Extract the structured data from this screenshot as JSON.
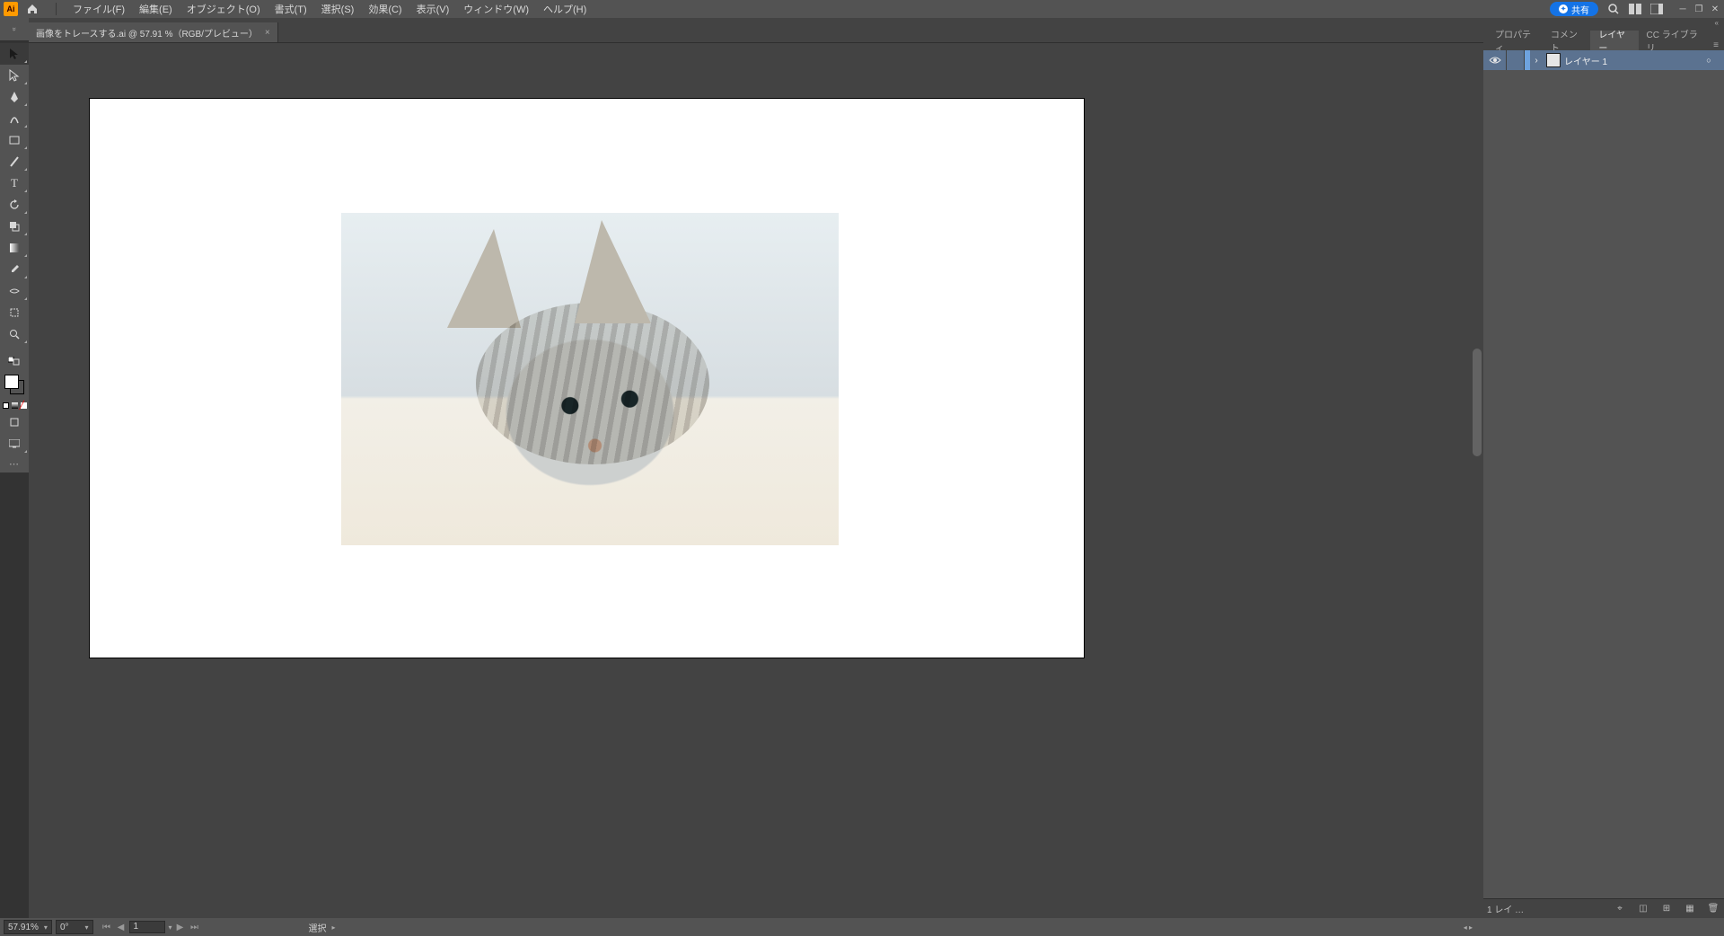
{
  "app": {
    "logo_text": "Ai"
  },
  "menu": {
    "items": [
      "ファイル(F)",
      "編集(E)",
      "オブジェクト(O)",
      "書式(T)",
      "選択(S)",
      "効果(C)",
      "表示(V)",
      "ウィンドウ(W)",
      "ヘルプ(H)"
    ],
    "share_label": "共有"
  },
  "document": {
    "tab_title": "画像をトレースする.ai @ 57.91 %（RGB/プレビュー）",
    "close_glyph": "×"
  },
  "tools": {
    "list": [
      {
        "name": "selection-tool",
        "glyph": "▸",
        "selected": true
      },
      {
        "name": "direct-selection-tool",
        "glyph": "▹"
      },
      {
        "name": "pen-tool",
        "glyph": "✒"
      },
      {
        "name": "curvature-tool",
        "glyph": "✎"
      },
      {
        "name": "rectangle-tool",
        "glyph": "▭"
      },
      {
        "name": "paintbrush-tool",
        "glyph": "／"
      },
      {
        "name": "type-tool",
        "glyph": "T"
      },
      {
        "name": "rotate-tool",
        "glyph": "↻"
      },
      {
        "name": "shape-builder-tool",
        "glyph": "◆"
      },
      {
        "name": "width-tool",
        "glyph": "▥"
      },
      {
        "name": "eyedropper-tool",
        "glyph": "✐"
      },
      {
        "name": "symbol-sprayer-tool",
        "glyph": "✲"
      },
      {
        "name": "artboard-tool",
        "glyph": "☐"
      },
      {
        "name": "zoom-tool",
        "glyph": "🔍"
      }
    ],
    "swatch_tiny": [
      "#ffffff",
      "#000000",
      "#ff0000"
    ],
    "more_glyph": "⋯"
  },
  "canvas": {
    "image_description": "Photograph of a grey-brown tabby cat with white chest, lying down and looking left, soft light grey background",
    "artboard_bg": "#ffffff"
  },
  "panels": {
    "tabs": [
      {
        "label": "プロパティ",
        "active": false
      },
      {
        "label": "コメント",
        "active": false
      },
      {
        "label": "レイヤー",
        "active": true
      },
      {
        "label": "CC ライブラリ",
        "active": false
      }
    ],
    "layer": {
      "name": "レイヤー 1",
      "visible_glyph": "👁",
      "twirl_glyph": "›",
      "target_glyph": "○"
    },
    "footer": {
      "count_label": "1 レイ …"
    }
  },
  "status": {
    "zoom": "57.91%",
    "rotation": "0°",
    "artboard_page": "1",
    "tool_name": "選択",
    "nav": {
      "first": "⏮",
      "prev": "◀",
      "next": "▶",
      "last": "⏭"
    }
  },
  "colors": {
    "panel_bg": "#535353",
    "dark_bg": "#434343",
    "accent_blue": "#1473e6",
    "selection_row": "#5b7290",
    "layer_color": "#6ea3df"
  }
}
